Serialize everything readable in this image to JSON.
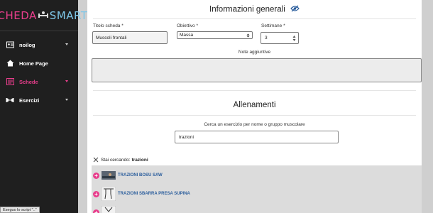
{
  "logo": {
    "left": "SCHEDA",
    "right": "SMART"
  },
  "nav": {
    "items": [
      {
        "label": "noilog",
        "icon": "id-card-icon",
        "caret": true,
        "active": false
      },
      {
        "label": "Home Page",
        "icon": "home-icon",
        "caret": false,
        "active": false
      },
      {
        "label": "Schede",
        "icon": "sheet-icon",
        "caret": true,
        "active": true
      },
      {
        "label": "Esercizi",
        "icon": "dumbbell-icon",
        "caret": true,
        "active": false
      }
    ]
  },
  "statusbar": {
    "text": "Eseguo lo script \"..\""
  },
  "general": {
    "title": "Informazioni generali",
    "titolo_label": "Titolo scheda *",
    "titolo_value": "Muscoli frontali",
    "obiettivo_label": "Obiettivo *",
    "obiettivo_value": "Massa",
    "settimane_label": "Settimane *",
    "settimane_value": "3",
    "note_label": "Note aggiuntive"
  },
  "workouts": {
    "title": "Allenamenti",
    "search_hint": "Cerca un esercizio per nome o gruppo muscolare",
    "search_value": "trazioni",
    "searching_prefix": "Stai cercando:",
    "searching_term": "trazioni"
  },
  "results": [
    {
      "label": "TRAZIONI BOSU SAW"
    },
    {
      "label": "TRAZIONI SBARRA PRESA SUPINA"
    }
  ],
  "colors": {
    "accent": "#e83e8c",
    "link": "#2a5d9c",
    "sidebar": "#1f1f1f"
  }
}
